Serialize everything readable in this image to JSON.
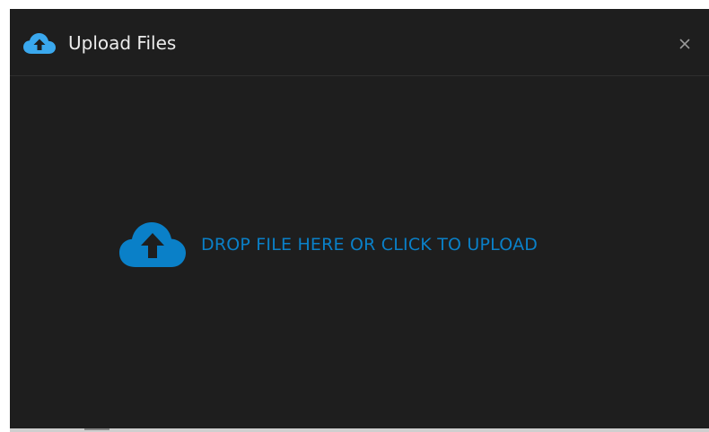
{
  "dialog": {
    "title": "Upload Files",
    "title_icon": "cloud-upload-icon",
    "close_icon": "close-icon",
    "close_symbol": "×"
  },
  "drop_zone": {
    "icon": "cloud-upload-icon",
    "text": "DROP FILE HERE OR CLICK TO UPLOAD"
  },
  "colors": {
    "background": "#1e1e1e",
    "header_icon": "#3aa8ee",
    "accent": "#0a80c8",
    "title": "#ececec",
    "close": "#9a9a9a"
  }
}
